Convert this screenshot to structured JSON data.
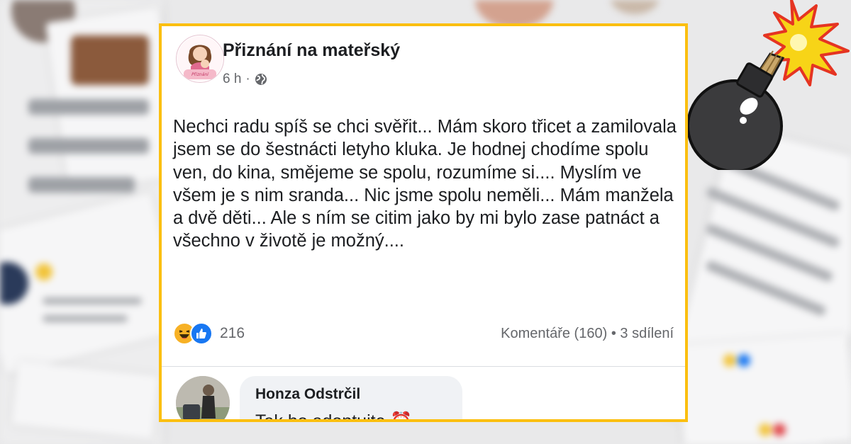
{
  "post": {
    "page_name": "Přiznání na mateřský",
    "time": "6 h",
    "separator": "·",
    "privacy_icon": "globe-icon",
    "body": "Nechci radu spíš se chci svěřit... Mám skoro třicet a zamilovala jsem se do šestnácti letyho kluka. Je hodnej chodíme spolu ven, do kina, smějeme se spolu, rozumíme si.... Myslím ve všem je s nim sranda... Nic jsme spolu neměli... Mám manžela a dvě děti... Ale s ním se citim jako by mi bylo zase patnáct a všechno v životě je možný....",
    "reactions": {
      "icons": [
        "haha-icon",
        "like-icon"
      ],
      "count": "216"
    },
    "comments_label": "Komentáře (160)",
    "stats_separator": "•",
    "shares_label": "3 sdílení"
  },
  "comment": {
    "author": "Honza Odstrčil",
    "text": "Tak ho adoptujte ⏰"
  },
  "colors": {
    "frame": "#fbbf10",
    "text": "#1c1e21",
    "muted": "#65676b",
    "like": "#1877f2",
    "haha": "#f7b125",
    "bubble": "#f0f2f5"
  },
  "decorations": {
    "bomb": "bomb-icon"
  }
}
